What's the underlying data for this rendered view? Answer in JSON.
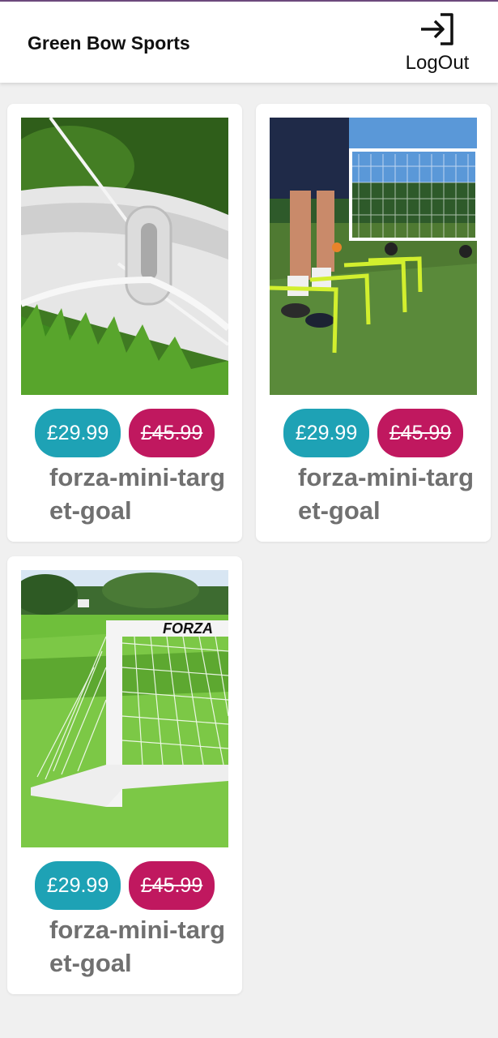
{
  "header": {
    "title": "Green Bow Sports",
    "logout_label": "LogOut"
  },
  "products": [
    {
      "price_new": "£29.99",
      "price_old": "£45.99",
      "name": "forza-mini-target-goal"
    },
    {
      "price_new": "£29.99",
      "price_old": "£45.99",
      "name": "forza-mini-target-goal"
    },
    {
      "price_new": "£29.99",
      "price_old": "£45.99",
      "name": "forza-mini-target-goal"
    }
  ],
  "product_images": [
    {
      "brand_text": "FORZA"
    }
  ],
  "colors": {
    "price_new_bg": "#1ea2b5",
    "price_old_bg": "#c0185f",
    "product_name": "#707070"
  }
}
